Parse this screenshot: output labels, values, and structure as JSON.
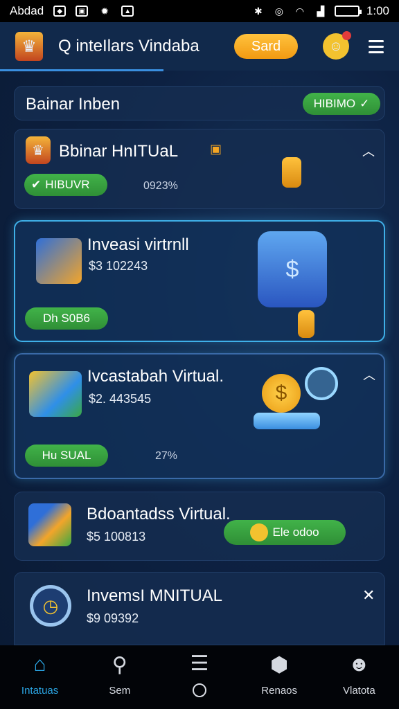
{
  "status_bar": {
    "carrier": "Abdad",
    "time": "1:00",
    "icons": [
      "notification-icon",
      "photo-icon",
      "settings-icon",
      "image-icon",
      "bluetooth-icon",
      "alarm-icon",
      "wifi-icon",
      "signal-icon",
      "battery-icon"
    ]
  },
  "header": {
    "search_text": "Q inteIlars Vindaba",
    "save_label": "Sard"
  },
  "summary": {
    "title": "Bainar Inben",
    "badge_label": "HIBIMO"
  },
  "cards": [
    {
      "title": "Bbinar HnITUaL",
      "status_label": "HIBUVR",
      "percent": "0923%"
    },
    {
      "title": "Inveasi virtrnll",
      "amount": "$3 102243",
      "button_label": "Dh S0B6"
    },
    {
      "title": "Ivcastabah Virtual.",
      "amount": "$2. 443545",
      "button_label": "Hu SUAL",
      "percent": "27%"
    },
    {
      "title": "Bdoantadss Virtual.",
      "amount": "$5 100813",
      "button_label": "Ele odoo"
    },
    {
      "title": "InvemsI MNITUAL",
      "amount": "$9 09392"
    }
  ],
  "nav": {
    "items": [
      {
        "label": "Intatuas",
        "icon": "home-icon"
      },
      {
        "label": "Sem",
        "icon": "search-icon"
      },
      {
        "label": "",
        "icon": "filter-icon"
      },
      {
        "label": "Renaos",
        "icon": "box-icon"
      },
      {
        "label": "Vlatota",
        "icon": "profile-icon"
      }
    ]
  },
  "colors": {
    "accent_green": "#3aa843",
    "accent_orange": "#f5a623",
    "accent_blue": "#2ba7e6",
    "background": "#0d2142"
  }
}
